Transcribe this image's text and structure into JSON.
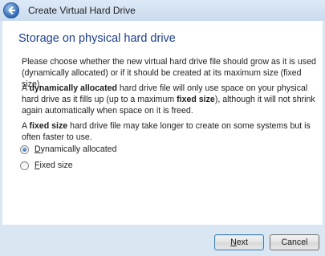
{
  "window": {
    "title": "Create Virtual Hard Drive"
  },
  "page": {
    "heading": "Storage on physical hard drive",
    "intro": "Please choose whether the new virtual hard drive file should grow as it is used (dynamically allocated) or if it should be created at its maximum size (fixed size).",
    "dynamic_paragraph": {
      "prefix": "A ",
      "bold_1": "dynamically allocated",
      "middle": " hard drive file will only use space on your physical hard drive as it fills up (up to a maximum ",
      "bold_2": "fixed size",
      "suffix": "), although it will not shrink again automatically when space on it is freed."
    },
    "fixed_paragraph": {
      "prefix": "A ",
      "bold": "fixed size",
      "suffix": " hard drive file may take longer to create on some systems but is often faster to use."
    },
    "options": [
      {
        "label_first": "D",
        "label_rest": "ynamically allocated",
        "checked": true
      },
      {
        "label_first": "F",
        "label_rest": "ixed size",
        "checked": false
      }
    ]
  },
  "footer": {
    "next": {
      "label_first": "N",
      "label_rest": "ext"
    },
    "cancel": {
      "label": "Cancel"
    }
  },
  "icons": {
    "back": "back-arrow-icon"
  },
  "colors": {
    "heading": "#1e3f8a",
    "chrome": "#d9e6f4",
    "back_button": "#2f67b3"
  }
}
